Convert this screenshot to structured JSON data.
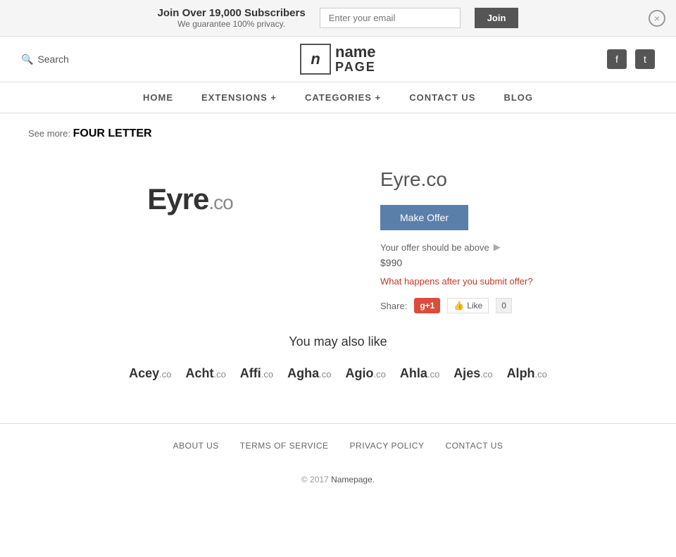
{
  "topBanner": {
    "title": "Join Over 19,000 Subscribers",
    "subtitle": "We guarantee 100% privacy.",
    "emailPlaceholder": "Enter your email",
    "joinLabel": "Join",
    "closeIcon": "×"
  },
  "header": {
    "searchLabel": "Search",
    "logoBox": "n",
    "logoName": "name",
    "logoPage": "PAGE",
    "facebookIcon": "f",
    "twitterIcon": "t"
  },
  "nav": {
    "items": [
      {
        "label": "HOME"
      },
      {
        "label": "EXTENSIONS +"
      },
      {
        "label": "CATEGORIES +"
      },
      {
        "label": "CONTACT US"
      },
      {
        "label": "BLOG"
      }
    ]
  },
  "seeMore": {
    "prefix": "See more:",
    "label": "FOUR LETTER"
  },
  "domainLogo": {
    "name": "Eyre",
    "tld": ".co"
  },
  "domainInfo": {
    "title": "Eyre.co",
    "makeOfferLabel": "Make Offer",
    "offerHintText": "Your offer should be above",
    "offerAmount": "$990",
    "offerLink": "What happens after you submit offer?",
    "shareLabel": "Share:",
    "gPlusLabel": "g+1",
    "fbLikeLabel": "Like",
    "fbCount": "0"
  },
  "alsoLike": {
    "title": "You may also like",
    "items": [
      {
        "name": "Acey",
        "tld": ".co"
      },
      {
        "name": "Acht",
        "tld": ".co"
      },
      {
        "name": "Affi",
        "tld": ".co"
      },
      {
        "name": "Agha",
        "tld": ".co"
      },
      {
        "name": "Agio",
        "tld": ".co"
      },
      {
        "name": "Ahla",
        "tld": ".co"
      },
      {
        "name": "Ajes",
        "tld": ".co"
      },
      {
        "name": "Alph",
        "tld": ".co"
      }
    ]
  },
  "footer": {
    "links": [
      {
        "label": "ABOUT US"
      },
      {
        "label": "TERMS OF SERVICE"
      },
      {
        "label": "PRIVACY POLICY"
      },
      {
        "label": "CONTACT US"
      }
    ],
    "copyright": "© 2017",
    "copyrightLink": "Namepage.",
    "copyrightLinkHref": "#"
  }
}
